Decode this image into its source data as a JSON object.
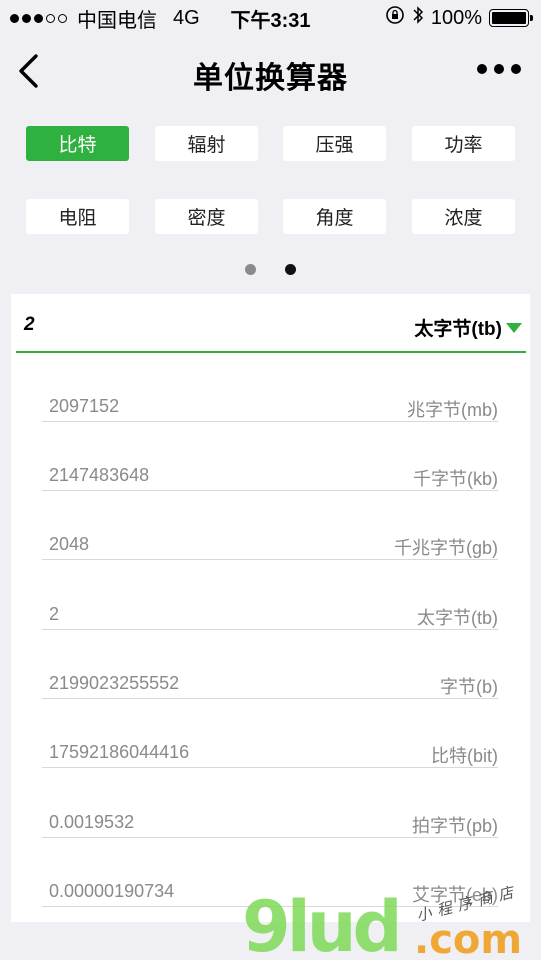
{
  "status_bar": {
    "carrier": "中国电信",
    "network": "4G",
    "time": "下午3:31",
    "battery_percent": "100%"
  },
  "nav": {
    "title": "单位换算器",
    "back_icon": "chevron-left-icon",
    "more_icon": "more-dots-icon"
  },
  "categories": [
    {
      "label": "比特",
      "active": true
    },
    {
      "label": "辐射",
      "active": false
    },
    {
      "label": "压强",
      "active": false
    },
    {
      "label": "功率",
      "active": false
    },
    {
      "label": "电阻",
      "active": false
    },
    {
      "label": "密度",
      "active": false
    },
    {
      "label": "角度",
      "active": false
    },
    {
      "label": "浓度",
      "active": false
    }
  ],
  "pager": {
    "pages": 2,
    "current": 2
  },
  "input": {
    "value": "2",
    "unit": "太字节(tb)"
  },
  "results": [
    {
      "value": "2097152",
      "unit": "兆字节(mb)"
    },
    {
      "value": "2147483648",
      "unit": "千字节(kb)"
    },
    {
      "value": "2048",
      "unit": "千兆字节(gb)"
    },
    {
      "value": "2",
      "unit": "太字节(tb)"
    },
    {
      "value": "2199023255552",
      "unit": "字节(b)"
    },
    {
      "value": "17592186044416",
      "unit": "比特(bit)"
    },
    {
      "value": "0.0019532",
      "unit": "拍字节(pb)"
    },
    {
      "value": "0.00000190734",
      "unit": "艾字节(eb)"
    }
  ],
  "watermark": {
    "brand": "9lud",
    "domain": ".com",
    "tagline": "小程序商店"
  },
  "colors": {
    "accent": "#2fb13f",
    "background": "#efeff4"
  }
}
